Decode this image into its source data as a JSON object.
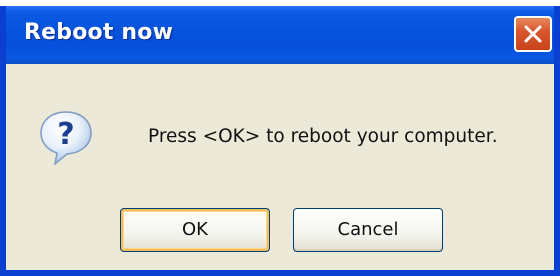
{
  "window": {
    "title": "Reboot now"
  },
  "message": {
    "text": "Press <OK> to reboot your computer.",
    "icon": "question-icon"
  },
  "buttons": {
    "ok_label": "OK",
    "cancel_label": "Cancel"
  },
  "colors": {
    "titlebar": "#0653dc",
    "dialog_bg": "#ece9d8",
    "close_button": "#d9582e",
    "default_button_focus": "#f3bf5a"
  }
}
